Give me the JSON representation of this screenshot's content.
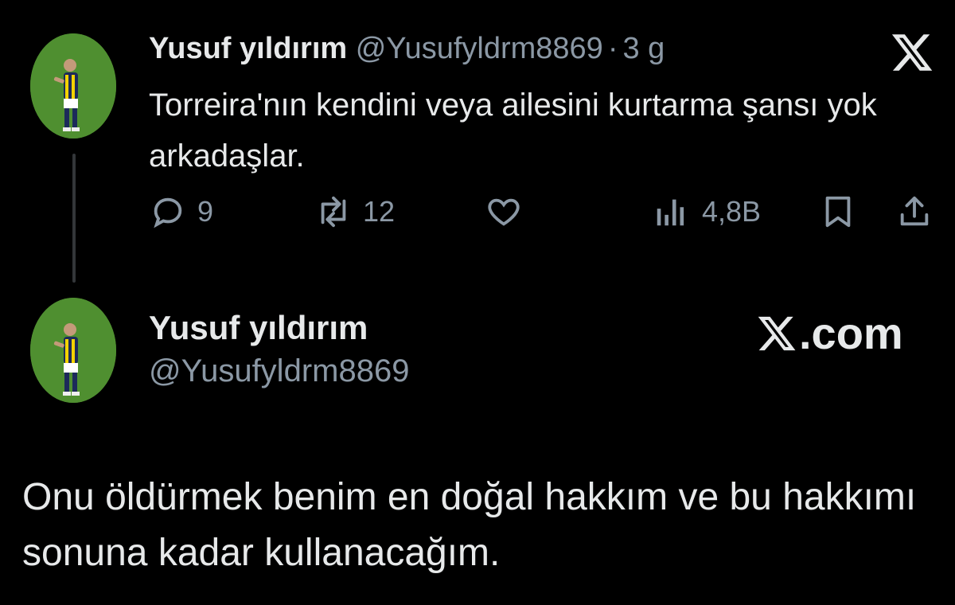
{
  "tweet1": {
    "display_name": "Yusuf yıldırım",
    "handle": "@Yusufyldrm8869",
    "separator": "·",
    "time": "3 g",
    "text": "Torreira'nın kendini veya ailesini kurtarma şansı yok arkadaşlar.",
    "platform_icon": "x-logo-icon",
    "actions": {
      "reply": {
        "icon": "reply-icon",
        "count": "9"
      },
      "repost": {
        "icon": "repost-icon",
        "count": "12"
      },
      "like": {
        "icon": "heart-icon",
        "count": ""
      },
      "views": {
        "icon": "views-icon",
        "count": "4,8B"
      },
      "bookmark": {
        "icon": "bookmark-icon"
      },
      "share": {
        "icon": "share-icon"
      }
    }
  },
  "tweet2": {
    "display_name": "Yusuf yıldırım",
    "handle": "@Yusufyldrm8869",
    "brand": ".com",
    "text": "Onu öldürmek benim en doğal hakkım ve bu hakkımı sonuna kadar kullanacağım."
  },
  "colors": {
    "background": "#000000",
    "text": "#e7e9ea",
    "muted": "#8b98a5",
    "thread_line": "#333639"
  }
}
